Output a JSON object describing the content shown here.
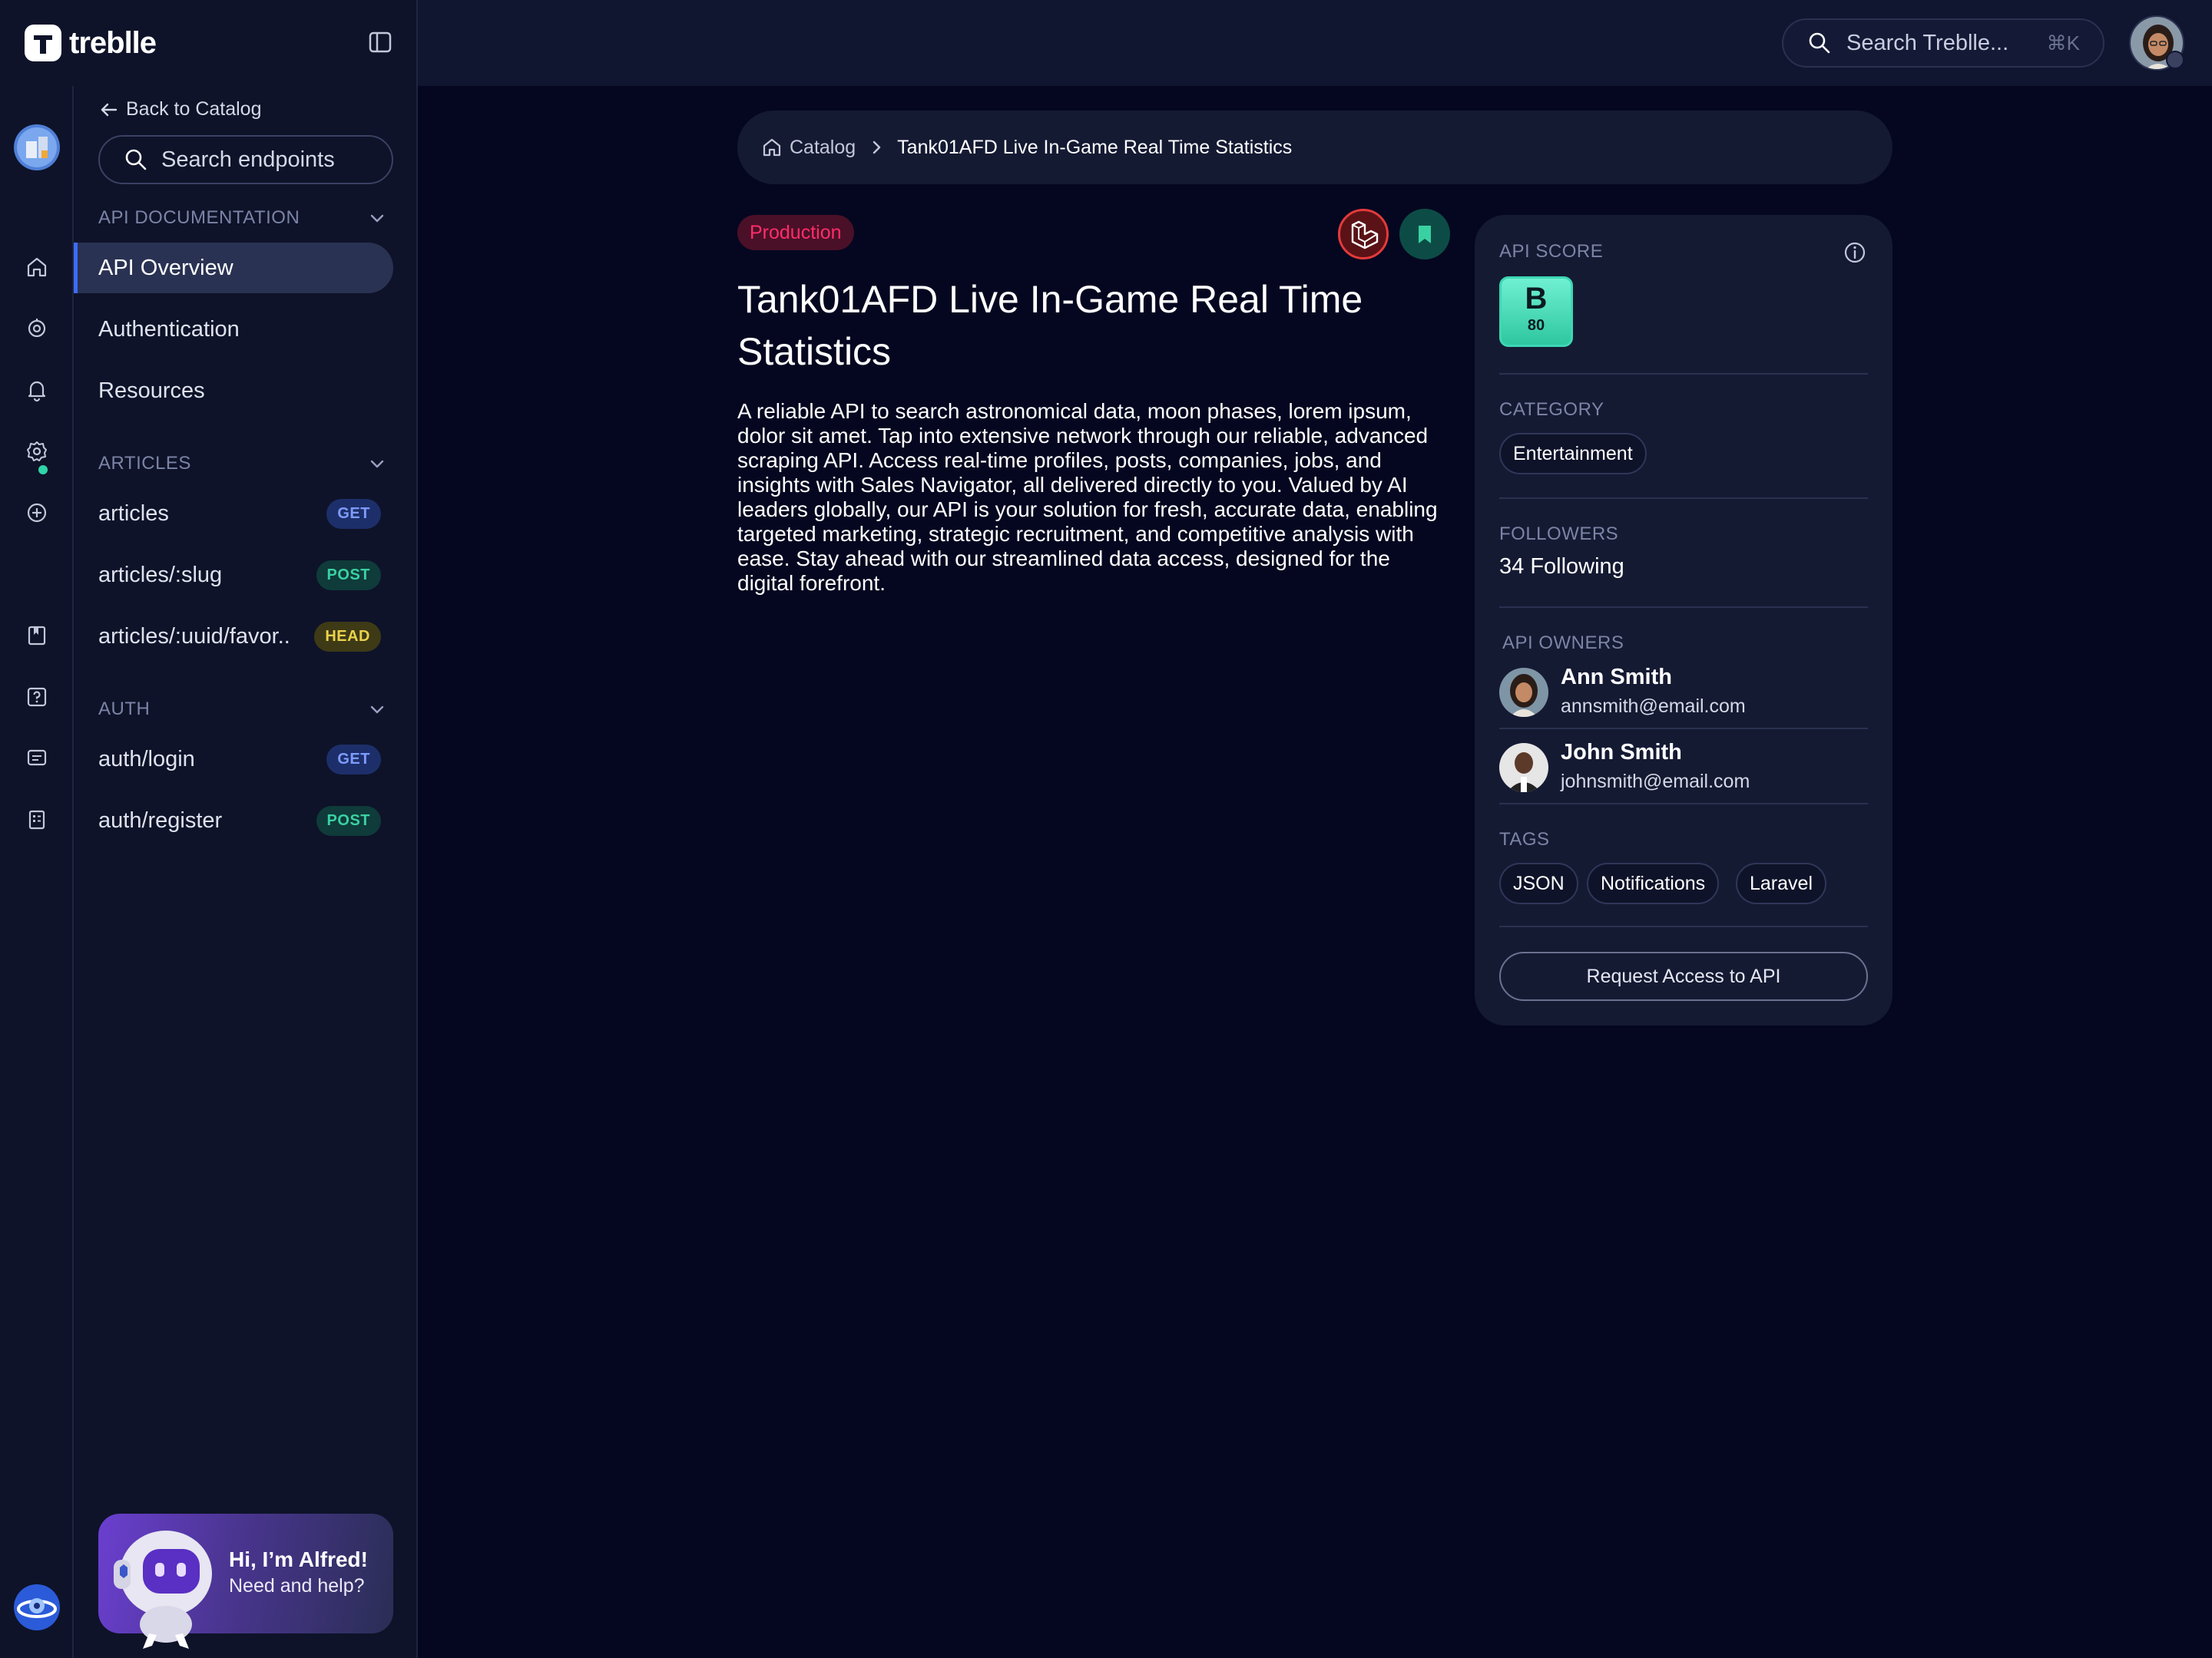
{
  "app": {
    "logo_text": "treblle",
    "global_search_placeholder": "Search Treblle...",
    "global_search_shortcut": "⌘K"
  },
  "rail": {
    "icons": [
      "home-icon",
      "monitoring-icon",
      "notifications-icon",
      "settings-icon",
      "add-icon",
      "catalog-icon",
      "help-icon",
      "feedback-icon",
      "docs-icon"
    ]
  },
  "sidebar": {
    "back_label": "Back to Catalog",
    "search_placeholder": "Search endpoints",
    "sections": [
      {
        "title": "API DOCUMENTATION",
        "items": [
          {
            "label": "API Overview"
          },
          {
            "label": "Authentication"
          },
          {
            "label": "Resources"
          }
        ]
      },
      {
        "title": "ARTICLES",
        "items": [
          {
            "label": "articles",
            "method": "GET"
          },
          {
            "label": "articles/:slug",
            "method": "POST"
          },
          {
            "label": "articles/:uuid/favor..",
            "method": "HEAD"
          }
        ]
      },
      {
        "title": "AUTH",
        "items": [
          {
            "label": "auth/login",
            "method": "GET"
          },
          {
            "label": "auth/register",
            "method": "POST"
          }
        ]
      }
    ],
    "assistant": {
      "title": "Hi, I’m Alfred!",
      "subtitle": "Need and help?"
    }
  },
  "breadcrumb": {
    "root": "Catalog",
    "current": "Tank01AFD Live In-Game Real Time Statistics"
  },
  "api": {
    "environment": "Production",
    "title": "Tank01AFD Live In-Game Real Time Statistics",
    "description": "A reliable API to search astronomical data, moon phases, lorem ipsum, dolor sit amet. Tap into extensive network through our reliable, advanced scraping API. Access real-time profiles, posts, companies, jobs, and insights with Sales Navigator, all delivered directly to you. Valued by AI leaders globally, our API is your solution for fresh, accurate data, enabling targeted marketing, strategic recruitment, and competitive analysis with ease. Stay ahead with our streamlined data access, designed for the digital forefront."
  },
  "details": {
    "score_label": "API SCORE",
    "score_grade": "B",
    "score_value": "80",
    "category_label": "CATEGORY",
    "category": "Entertainment",
    "followers_label": "FOLLOWERS",
    "followers_value": "34 Following",
    "owners_label": "API OWNERS",
    "owners": [
      {
        "name": "Ann Smith",
        "email": "annsmith@email.com"
      },
      {
        "name": "John Smith",
        "email": "johnsmith@email.com"
      }
    ],
    "tags_label": "TAGS",
    "tags": [
      "JSON",
      "Notifications",
      "Laravel"
    ],
    "request_button": "Request Access to API"
  },
  "colors": {
    "background": "#050720",
    "panel": "#0e1329",
    "card": "#151a33",
    "accent_blue": "#3d6bff",
    "get": "#7d9cff",
    "post": "#3ad1a2",
    "head": "#ead34c",
    "production": "#ff2d6a",
    "score": "#3cd8b4"
  }
}
